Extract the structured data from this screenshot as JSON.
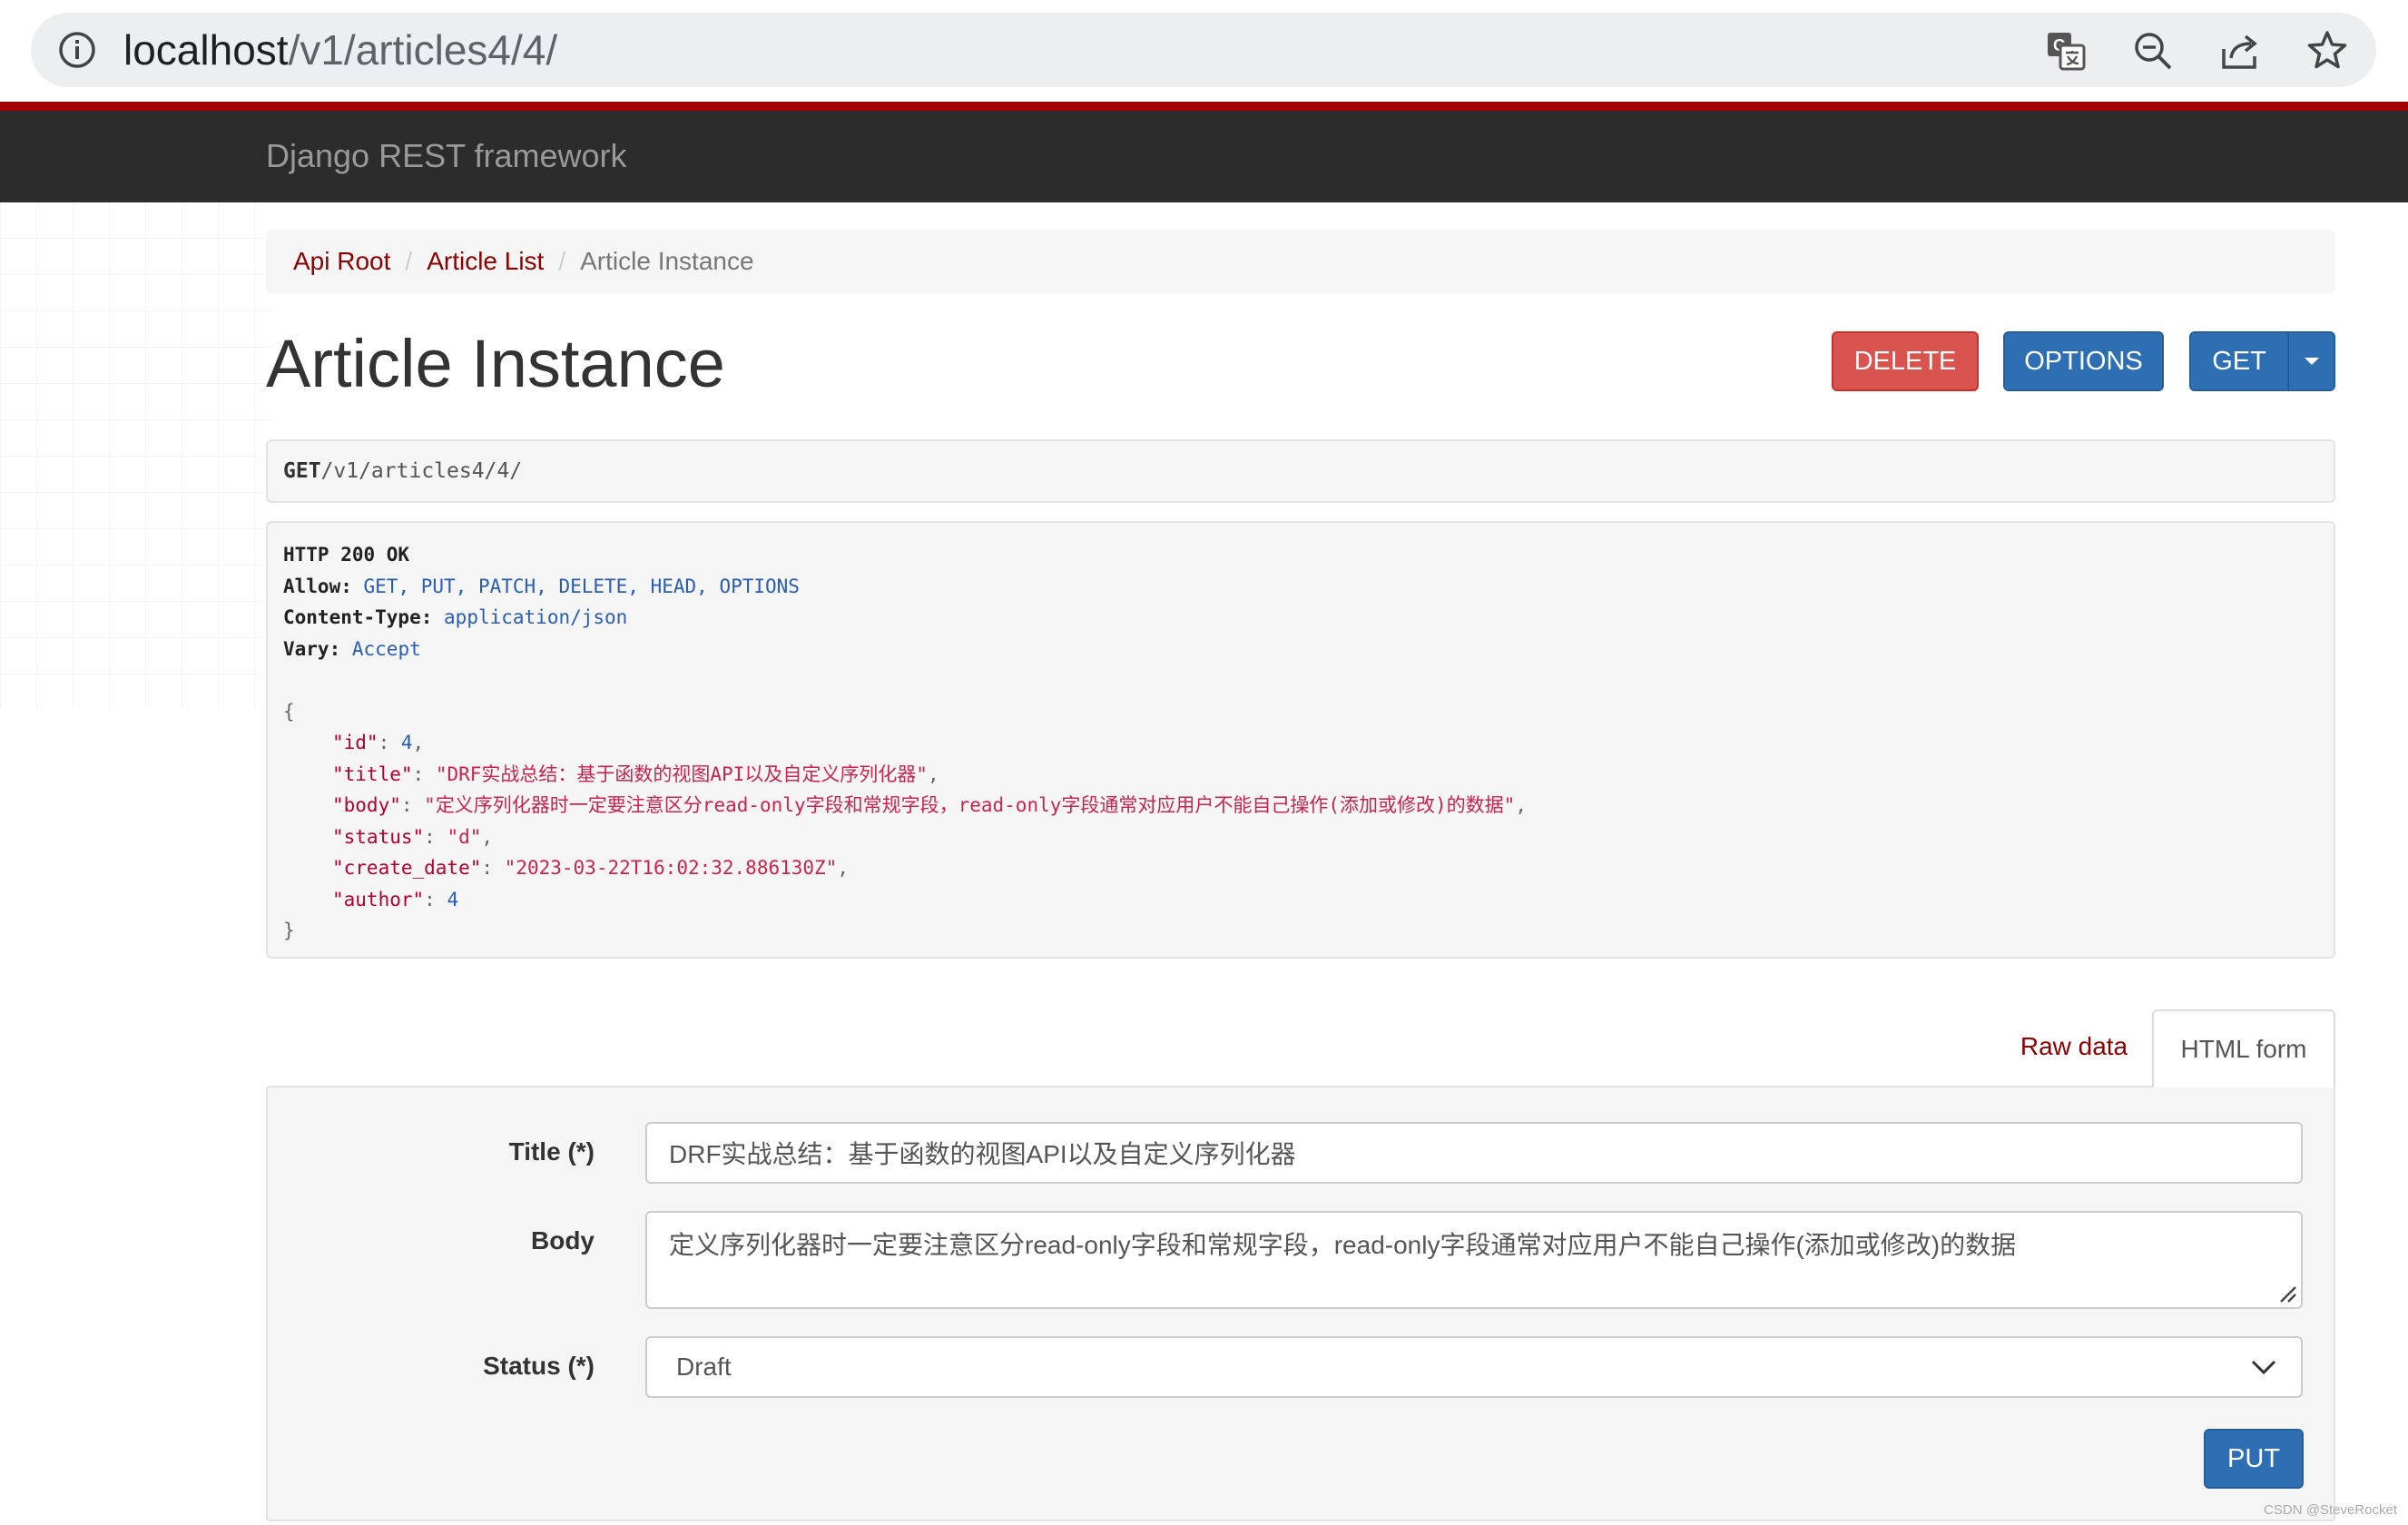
{
  "browser": {
    "url_host": "localhost",
    "url_path": "/v1/articles4/4/"
  },
  "navbar": {
    "brand": "Django REST framework"
  },
  "breadcrumb": {
    "items": [
      "Api Root",
      "Article List",
      "Article Instance"
    ],
    "separator": "/"
  },
  "page_title": "Article Instance",
  "actions": {
    "delete_label": "DELETE",
    "options_label": "OPTIONS",
    "get_label": "GET"
  },
  "request": {
    "method": "GET",
    "path": "/v1/articles4/4/"
  },
  "response": {
    "status_line": "HTTP 200 OK",
    "headers": [
      {
        "key": "Allow:",
        "value": "GET, PUT, PATCH, DELETE, HEAD, OPTIONS"
      },
      {
        "key": "Content-Type:",
        "value": "application/json"
      },
      {
        "key": "Vary:",
        "value": "Accept"
      }
    ],
    "body": {
      "open": "{",
      "close": "}",
      "fields": [
        {
          "key": "\"id\"",
          "value": "4",
          "type": "num",
          "comma": ","
        },
        {
          "key": "\"title\"",
          "value": "\"DRF实战总结：基于函数的视图API以及自定义序列化器\"",
          "type": "str",
          "comma": ","
        },
        {
          "key": "\"body\"",
          "value": "\"定义序列化器时一定要注意区分read-only字段和常规字段，read-only字段通常对应用户不能自己操作(添加或修改)的数据\"",
          "type": "str",
          "comma": ","
        },
        {
          "key": "\"status\"",
          "value": "\"d\"",
          "type": "str",
          "comma": ","
        },
        {
          "key": "\"create_date\"",
          "value": "\"2023-03-22T16:02:32.886130Z\"",
          "type": "str",
          "comma": ","
        },
        {
          "key": "\"author\"",
          "value": "4",
          "type": "num",
          "comma": ""
        }
      ]
    }
  },
  "tabs": {
    "raw_label": "Raw data",
    "html_label": "HTML form"
  },
  "form": {
    "title_label": "Title (*)",
    "title_value": "DRF实战总结：基于函数的视图API以及自定义序列化器",
    "body_label": "Body",
    "body_value": "定义序列化器时一定要注意区分read-only字段和常规字段，read-only字段通常对应用户不能自己操作(添加或修改)的数据",
    "status_label": "Status (*)",
    "status_value": "Draft",
    "submit_label": "PUT"
  },
  "watermark": "CSDN @SteveRocket",
  "colors": {
    "navbar_bg": "#2c2c2c",
    "accent_red": "#a30000",
    "link": "#8b0000",
    "primary_btn": "#2e6fb3",
    "danger_btn": "#d9534f"
  }
}
